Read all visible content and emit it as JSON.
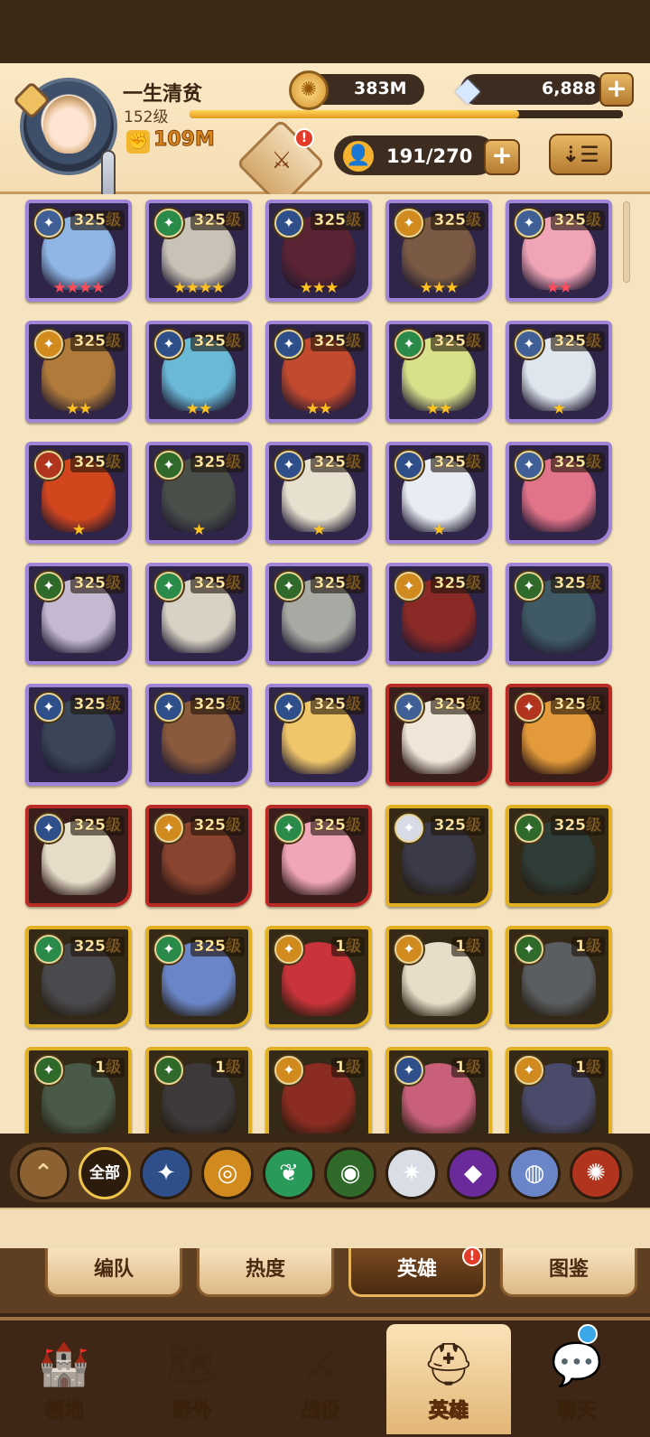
{
  "player": {
    "name": "一生清贫",
    "level": "152级",
    "xp_fraction": 0.76,
    "power": "109M",
    "power_icon": "fist-icon"
  },
  "resources": {
    "gold": "383M",
    "gems": "6,888",
    "gold_icon": "gold-coin-icon",
    "gem_icon": "diamond-icon"
  },
  "roster": {
    "count": "191/270",
    "event_alert": "!",
    "sort_glyph": "⇣☰"
  },
  "heroes": [
    {
      "level": "325级",
      "frame": "mythic",
      "faction": "celestial",
      "stars": "★★★★",
      "star_color": "red",
      "portrait": "#8fb6e4"
    },
    {
      "level": "325级",
      "frame": "mythic",
      "faction": "wilder",
      "stars": "★★★★",
      "star_color": "gold",
      "portrait": "#c9c2b6"
    },
    {
      "level": "325级",
      "frame": "mythic",
      "faction": "lightbearer",
      "stars": "★★★",
      "star_color": "gold",
      "portrait": "#5a2434"
    },
    {
      "level": "325级",
      "frame": "mythic",
      "faction": "mauler",
      "stars": "★★★",
      "star_color": "gold",
      "portrait": "#7a5a44"
    },
    {
      "level": "325级",
      "frame": "mythic",
      "faction": "celestial",
      "stars": "★★",
      "star_color": "red",
      "portrait": "#f0a4b6"
    },
    {
      "level": "325级",
      "frame": "mythic",
      "faction": "mauler",
      "stars": "★★",
      "star_color": "gold",
      "portrait": "#b07a3a"
    },
    {
      "level": "325级",
      "frame": "mythic",
      "faction": "lightbearer",
      "stars": "★★",
      "star_color": "gold",
      "portrait": "#6ab9d6"
    },
    {
      "level": "325级",
      "frame": "mythic",
      "faction": "lightbearer",
      "stars": "★★",
      "star_color": "gold",
      "portrait": "#c24a2e"
    },
    {
      "level": "325级",
      "frame": "mythic",
      "faction": "wilder",
      "stars": "★★",
      "star_color": "gold",
      "portrait": "#d9e08a"
    },
    {
      "level": "325级",
      "frame": "mythic",
      "faction": "celestial",
      "stars": "★",
      "star_color": "gold",
      "portrait": "#dfe6ee"
    },
    {
      "level": "325级",
      "frame": "mythic",
      "faction": "hypogean",
      "stars": "★",
      "star_color": "gold",
      "portrait": "#d2461e"
    },
    {
      "level": "325级",
      "frame": "mythic",
      "faction": "graveborn",
      "stars": "★",
      "star_color": "gold",
      "portrait": "#4a4f4a"
    },
    {
      "level": "325级",
      "frame": "mythic",
      "faction": "lightbearer",
      "stars": "★",
      "star_color": "gold",
      "portrait": "#e8e0cf"
    },
    {
      "level": "325级",
      "frame": "mythic",
      "faction": "lightbearer",
      "stars": "★",
      "star_color": "gold",
      "portrait": "#e8ecf3"
    },
    {
      "level": "325级",
      "frame": "mythic",
      "faction": "celestial",
      "stars": "",
      "star_color": "gold",
      "portrait": "#e2748a"
    },
    {
      "level": "325级",
      "frame": "mythic",
      "faction": "graveborn",
      "stars": "",
      "star_color": "gold",
      "portrait": "#c4b9d0"
    },
    {
      "level": "325级",
      "frame": "mythic",
      "faction": "wilder",
      "stars": "",
      "star_color": "gold",
      "portrait": "#d8d2c4"
    },
    {
      "level": "325级",
      "frame": "mythic",
      "faction": "graveborn",
      "stars": "",
      "star_color": "gold",
      "portrait": "#a6aaa2"
    },
    {
      "level": "325级",
      "frame": "mythic",
      "faction": "mauler",
      "stars": "",
      "star_color": "gold",
      "portrait": "#8a2a26"
    },
    {
      "level": "325级",
      "frame": "mythic",
      "faction": "graveborn",
      "stars": "",
      "star_color": "gold",
      "portrait": "#3f5a64"
    },
    {
      "level": "325级",
      "frame": "mythic",
      "faction": "lightbearer",
      "stars": "",
      "star_color": "gold",
      "portrait": "#3a4658"
    },
    {
      "level": "325级",
      "frame": "mythic",
      "faction": "lightbearer",
      "stars": "",
      "star_color": "gold",
      "portrait": "#8a5a3c"
    },
    {
      "level": "325级",
      "frame": "mythic",
      "faction": "lightbearer",
      "stars": "",
      "star_color": "gold",
      "portrait": "#f0c66a"
    },
    {
      "level": "325级",
      "frame": "ascended",
      "faction": "celestial",
      "stars": "",
      "star_color": "gold",
      "portrait": "#efe6d8"
    },
    {
      "level": "325级",
      "frame": "ascended",
      "faction": "hypogean",
      "stars": "",
      "star_color": "gold",
      "portrait": "#e29a3a"
    },
    {
      "level": "325级",
      "frame": "ascended",
      "faction": "lightbearer",
      "stars": "",
      "star_color": "gold",
      "portrait": "#e6dcc8"
    },
    {
      "level": "325级",
      "frame": "ascended",
      "faction": "mauler",
      "stars": "",
      "star_color": "gold",
      "portrait": "#8a4430"
    },
    {
      "level": "325级",
      "frame": "ascended",
      "faction": "wilder",
      "stars": "",
      "star_color": "gold",
      "portrait": "#f0a6b6"
    },
    {
      "level": "325级",
      "frame": "legendary",
      "faction": "celestial-white",
      "stars": "",
      "star_color": "gold",
      "portrait": "#3a3a48"
    },
    {
      "level": "325级",
      "frame": "legendary",
      "faction": "graveborn",
      "stars": "",
      "star_color": "gold",
      "portrait": "#2f3d38"
    },
    {
      "level": "325级",
      "frame": "legendary",
      "faction": "wilder",
      "stars": "",
      "star_color": "gold",
      "portrait": "#4a4a4e"
    },
    {
      "level": "325级",
      "frame": "legendary",
      "faction": "wilder",
      "stars": "",
      "star_color": "gold",
      "portrait": "#6a86c8"
    },
    {
      "level": "1级",
      "frame": "legendary",
      "faction": "mauler",
      "stars": "",
      "star_color": "gold",
      "portrait": "#c8343a"
    },
    {
      "level": "1级",
      "frame": "legendary",
      "faction": "mauler",
      "stars": "",
      "star_color": "gold",
      "portrait": "#e8ddc8"
    },
    {
      "level": "1级",
      "frame": "legendary",
      "faction": "graveborn",
      "stars": "",
      "star_color": "gold",
      "portrait": "#5a5e60"
    },
    {
      "level": "1级",
      "frame": "legendary",
      "faction": "graveborn",
      "stars": "",
      "star_color": "gold",
      "portrait": "#4a5a48"
    },
    {
      "level": "1级",
      "frame": "legendary",
      "faction": "graveborn",
      "stars": "",
      "star_color": "gold",
      "portrait": "#3e3a3c"
    },
    {
      "level": "1级",
      "frame": "legendary",
      "faction": "mauler",
      "stars": "",
      "star_color": "gold",
      "portrait": "#8a2c22"
    },
    {
      "level": "1级",
      "frame": "legendary",
      "faction": "lightbearer",
      "stars": "",
      "star_color": "gold",
      "portrait": "#c8607a"
    },
    {
      "level": "1级",
      "frame": "legendary",
      "faction": "mauler",
      "stars": "",
      "star_color": "gold",
      "portrait": "#4a4a6a"
    }
  ],
  "faction_colors": {
    "celestial": "#3f5f96",
    "celestial-white": "#d6dbe6",
    "wilder": "#2a8a4a",
    "graveborn": "#2f6a2a",
    "lightbearer": "#2e4f8a",
    "mauler": "#d08a1e",
    "hypogean": "#b0341e"
  },
  "filter_bar": {
    "collapse_glyph": "⌃",
    "all_label": "全部",
    "factions": [
      {
        "name": "lightbearer-filter-icon",
        "glyph": "✦",
        "color": "#2e4f8a"
      },
      {
        "name": "mauler-filter-icon",
        "glyph": "◎",
        "color": "#d08a1e"
      },
      {
        "name": "wilder-filter-icon",
        "glyph": "❦",
        "color": "#2a9a5a"
      },
      {
        "name": "graveborn-filter-icon",
        "glyph": "◉",
        "color": "#2f6a2a"
      },
      {
        "name": "celestial-filter-icon",
        "glyph": "✷",
        "color": "#d9dde6"
      },
      {
        "name": "hypogean-filter-icon",
        "glyph": "◆",
        "color": "#6a2a9a"
      },
      {
        "name": "dimensional-filter-icon",
        "glyph": "◍",
        "color": "#6a86c8"
      },
      {
        "name": "hypogean-red-filter-icon",
        "glyph": "✺",
        "color": "#b0341e"
      }
    ]
  },
  "subtabs": [
    {
      "label": "编队",
      "active": false
    },
    {
      "label": "热度",
      "active": false
    },
    {
      "label": "英雄",
      "active": true
    },
    {
      "label": "图鉴",
      "active": false
    }
  ],
  "subtab_alert": "!",
  "nav": [
    {
      "label": "领地",
      "icon": "castle-icon",
      "glyph": "🏰",
      "active": false
    },
    {
      "label": "野外",
      "icon": "scroll-map-icon",
      "glyph": "🗺",
      "active": false
    },
    {
      "label": "战役",
      "icon": "sword-icon",
      "glyph": "⚔",
      "active": false
    },
    {
      "label": "英雄",
      "icon": "helmet-icon",
      "glyph": "⛑",
      "active": true
    },
    {
      "label": "聊天",
      "icon": "chat-icon",
      "glyph": "💬",
      "active": false
    }
  ]
}
